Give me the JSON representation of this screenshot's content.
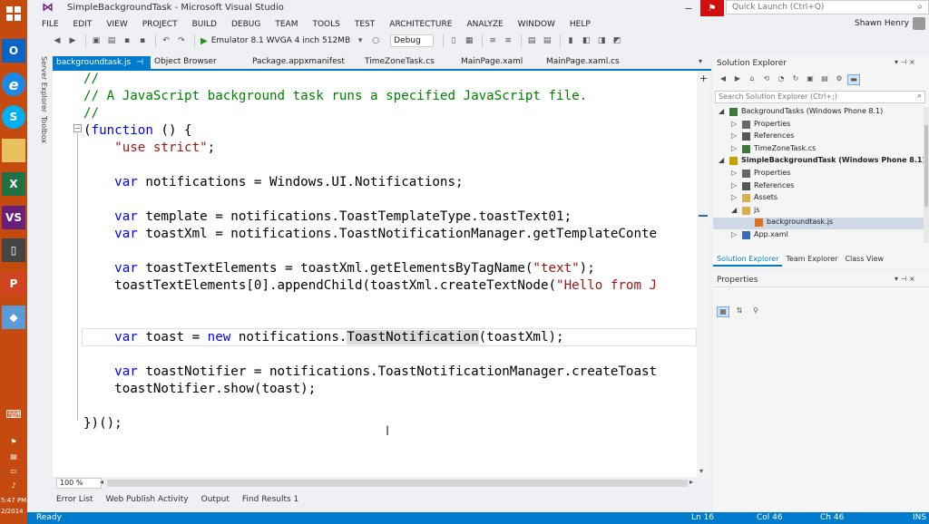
{
  "window": {
    "title": "SimpleBackgroundTask - Microsoft Visual Studio",
    "quick_launch_placeholder": "Quick Launch (Ctrl+Q)",
    "user_name": "Shawn Henry"
  },
  "menu": [
    "FILE",
    "EDIT",
    "VIEW",
    "PROJECT",
    "BUILD",
    "DEBUG",
    "TEAM",
    "TOOLS",
    "TEST",
    "ARCHITECTURE",
    "ANALYZE",
    "WINDOW",
    "HELP"
  ],
  "toolbar": {
    "run_target": "Emulator 8.1 WVGA 4 inch 512MB",
    "configuration": "Debug"
  },
  "side_tabs": [
    "Server Explorer",
    "Toolbox"
  ],
  "doc_tabs": [
    {
      "label": "backgroundtask.js",
      "active": true
    },
    {
      "label": "Object Browser",
      "active": false
    },
    {
      "label": "Package.appxmanifest",
      "active": false
    },
    {
      "label": "TimeZoneTask.cs",
      "active": false
    },
    {
      "label": "MainPage.xaml",
      "active": false
    },
    {
      "label": "MainPage.xaml.cs",
      "active": false
    }
  ],
  "code_lines": [
    [
      {
        "t": "//",
        "c": "cmt"
      }
    ],
    [
      {
        "t": "// A JavaScript background task runs a specified JavaScript file.",
        "c": "cmt"
      }
    ],
    [
      {
        "t": "//",
        "c": "cmt"
      }
    ],
    [
      {
        "t": "(",
        "c": "txt"
      },
      {
        "t": "function",
        "c": "kw"
      },
      {
        "t": " () {",
        "c": "txt"
      }
    ],
    [
      {
        "t": "    ",
        "c": "txt"
      },
      {
        "t": "\"use strict\"",
        "c": "str"
      },
      {
        "t": ";",
        "c": "txt"
      }
    ],
    [],
    [
      {
        "t": "    ",
        "c": "txt"
      },
      {
        "t": "var",
        "c": "kw"
      },
      {
        "t": " notifications = Windows.UI.Notifications;",
        "c": "txt"
      }
    ],
    [],
    [
      {
        "t": "    ",
        "c": "txt"
      },
      {
        "t": "var",
        "c": "kw"
      },
      {
        "t": " template = notifications.ToastTemplateType.toastText01;",
        "c": "txt"
      }
    ],
    [
      {
        "t": "    ",
        "c": "txt"
      },
      {
        "t": "var",
        "c": "kw"
      },
      {
        "t": " toastXml = notifications.ToastNotificationManager.getTemplateConte",
        "c": "txt"
      }
    ],
    [],
    [
      {
        "t": "    ",
        "c": "txt"
      },
      {
        "t": "var",
        "c": "kw"
      },
      {
        "t": " toastTextElements = toastXml.getElementsByTagName(",
        "c": "txt"
      },
      {
        "t": "\"text\"",
        "c": "str"
      },
      {
        "t": ");",
        "c": "txt"
      }
    ],
    [
      {
        "t": "    toastTextElements[0].appendChild(toastXml.createTextNode(",
        "c": "txt"
      },
      {
        "t": "\"Hello from J",
        "c": "str"
      }
    ],
    [],
    [],
    [
      {
        "t": "    ",
        "c": "txt"
      },
      {
        "t": "var",
        "c": "kw"
      },
      {
        "t": " toast = ",
        "c": "txt"
      },
      {
        "t": "new",
        "c": "kw"
      },
      {
        "t": " notifications.",
        "c": "txt"
      },
      {
        "t": "ToastNotification",
        "c": "txt hl"
      },
      {
        "t": "(toastXml);",
        "c": "txt"
      }
    ],
    [],
    [
      {
        "t": "    ",
        "c": "txt"
      },
      {
        "t": "var",
        "c": "kw"
      },
      {
        "t": " toastNotifier = notifications.ToastNotificationManager.createToast",
        "c": "txt"
      }
    ],
    [
      {
        "t": "    toastNotifier.show(toast);",
        "c": "txt"
      }
    ],
    [],
    [
      {
        "t": "})();",
        "c": "txt"
      }
    ]
  ],
  "editor": {
    "zoom": "100 %"
  },
  "bottom_tabs": [
    "Error List",
    "Web Publish Activity",
    "Output",
    "Find Results 1"
  ],
  "status": {
    "state": "Ready",
    "line": "Ln 16",
    "col": "Col 46",
    "ch": "Ch 46",
    "mode": "INS"
  },
  "solution_explorer": {
    "title": "Solution Explorer",
    "search_placeholder": "Search Solution Explorer (Ctrl+;)",
    "tree": [
      {
        "label": "BackgroundTasks (Windows Phone 8.1)",
        "depth": 0,
        "arrow": "◢",
        "icon": "cs-project",
        "bold": false
      },
      {
        "label": "Properties",
        "depth": 1,
        "arrow": "▷",
        "icon": "wrench",
        "bold": false
      },
      {
        "label": "References",
        "depth": 1,
        "arrow": "▷",
        "icon": "refs",
        "bold": false
      },
      {
        "label": "TimeZoneTask.cs",
        "depth": 1,
        "arrow": "▷",
        "icon": "cs-file",
        "bold": false
      },
      {
        "label": "SimpleBackgroundTask (Windows Phone 8.1)",
        "depth": 0,
        "arrow": "◢",
        "icon": "js-project",
        "bold": true
      },
      {
        "label": "Properties",
        "depth": 1,
        "arrow": "▷",
        "icon": "wrench",
        "bold": false
      },
      {
        "label": "References",
        "depth": 1,
        "arrow": "▷",
        "icon": "refs",
        "bold": false
      },
      {
        "label": "Assets",
        "depth": 1,
        "arrow": "▷",
        "icon": "folder",
        "bold": false
      },
      {
        "label": "js",
        "depth": 1,
        "arrow": "◢",
        "icon": "folder-open",
        "bold": false
      },
      {
        "label": "backgroundtask.js",
        "depth": 2,
        "arrow": "",
        "icon": "js-file",
        "bold": false,
        "selected": true
      },
      {
        "label": "App.xaml",
        "depth": 1,
        "arrow": "▷",
        "icon": "xaml-file",
        "bold": false
      }
    ],
    "tabs": [
      {
        "label": "Solution Explorer",
        "active": true
      },
      {
        "label": "Team Explorer",
        "active": false
      },
      {
        "label": "Class View",
        "active": false
      }
    ]
  },
  "properties": {
    "title": "Properties"
  },
  "taskbar": {
    "outlook": "O",
    "ie": "e",
    "skype": "S",
    "excel": "X",
    "vs": "VS",
    "ppt": "P",
    "time": "5:47 PM",
    "date": "2/2014"
  },
  "colors": {
    "accent": "#007acc",
    "taskbar": "#c44a10",
    "keyword": "#0000ff",
    "comment": "#008000",
    "string": "#a31515"
  }
}
